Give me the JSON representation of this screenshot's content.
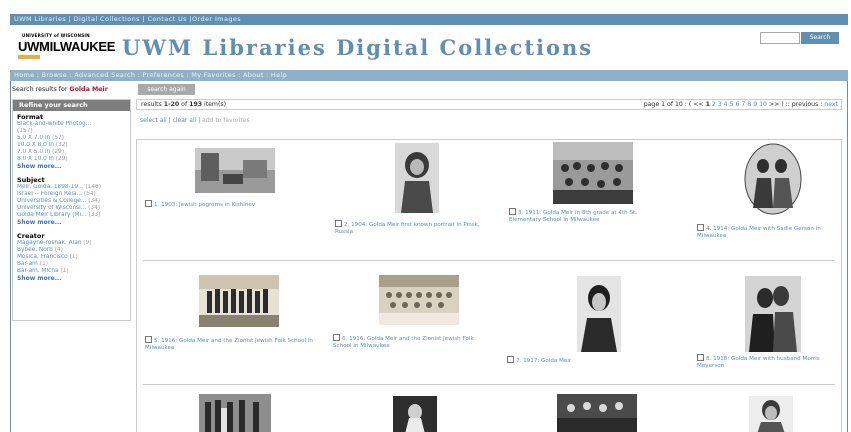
{
  "top_nav": "UWM Libraries | Digital Collections | Contact Us |Order Images",
  "logo": {
    "university": "UNIVERSITY of WISCONSIN",
    "name": "UWMILWAUKEE"
  },
  "site_title": "UWM Libraries Digital Collections",
  "header_search": {
    "button": "Search",
    "value": ""
  },
  "nav": "Home : Browse : Advanced Search : Preferences : My Favorites : About : Help",
  "search": {
    "prefix": "Search results for",
    "term": "Golda Meir",
    "again_button": "search again"
  },
  "sidebar": {
    "title": "Refine your search",
    "facets": [
      {
        "heading": "Format",
        "rows": [
          {
            "label": "Black-and-white Photog...",
            "count": ""
          },
          {
            "label": "",
            "count": "(157)"
          },
          {
            "label": "5.0 X 7.0 in",
            "count": "(57)"
          },
          {
            "label": "10.0 X 8.0 in",
            "count": "(32)"
          },
          {
            "label": "7.0 X 5.0 in",
            "count": "(29)"
          },
          {
            "label": "8.0 X 10.0 in",
            "count": "(29)"
          }
        ],
        "more": "Show more..."
      },
      {
        "heading": "Subject",
        "rows": [
          {
            "label": "Meir, Golda, 1898-19...",
            "count": "(146)"
          },
          {
            "label": "Israel -- Foreign Rela...",
            "count": "(54)"
          },
          {
            "label": "Universities & College...",
            "count": "(34)"
          },
          {
            "label": "University of Wisconsi...",
            "count": "(34)"
          },
          {
            "label": "Golda Meir Library (Mi...",
            "count": "(33)"
          }
        ],
        "more": "Show more..."
      },
      {
        "heading": "Creator",
        "rows": [
          {
            "label": "Magayne-roshak, Alan",
            "count": "(9)"
          },
          {
            "label": "Bybee, Norb",
            "count": "(4)"
          },
          {
            "label": "Mosica, Francisco",
            "count": "(1)"
          },
          {
            "label": "Bar-am",
            "count": "(1)"
          },
          {
            "label": "Bar-am, Micha",
            "count": "(1)"
          }
        ],
        "more": "Show more..."
      }
    ]
  },
  "results": {
    "summary_prefix": "results",
    "range": "1-20",
    "of": "of",
    "total": "193",
    "summary_suffix": "item(s)",
    "pager_text": "page 1 of 10 : ( << ",
    "pages": [
      "1",
      "2",
      "3",
      "4",
      "5",
      "6",
      "7",
      "8",
      "9",
      "10"
    ],
    "pager_tail": " >> ) :: previous : ",
    "next": "next",
    "select_all": "select all",
    "clear_all": "clear all",
    "add_fav": "add to favorites",
    "items": [
      {
        "num": "1.",
        "caption": "1903: Jewish pogroms in Kishinev"
      },
      {
        "num": "2.",
        "caption": "1904: Golda Meir first known portrait in Pinsk, Russia"
      },
      {
        "num": "3.",
        "caption": "1911: Golda Meir in 8th grade at 4th St. Elementary School in Milwaukee"
      },
      {
        "num": "4.",
        "caption": "1914: Golda Meir with Sadie Gerson in Milwaukee"
      },
      {
        "num": "5.",
        "caption": "1916: Golda Meir and the Zionist Jewish Folk School in Milwaukee"
      },
      {
        "num": "6.",
        "caption": "1916: Golda Meir and the Zionist Jewish Folk School in Milwaukee"
      },
      {
        "num": "7.",
        "caption": "1917: Golda Meir"
      },
      {
        "num": "8.",
        "caption": "1918: Golda Meir with husband Morris Meyerson"
      }
    ]
  }
}
